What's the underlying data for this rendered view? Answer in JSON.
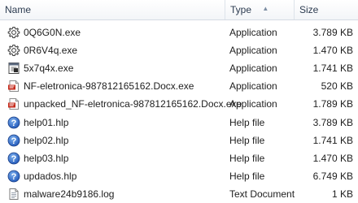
{
  "columns": {
    "name": "Name",
    "type": "Type",
    "type_sort_indicator": "▲",
    "size": "Size"
  },
  "files": [
    {
      "name": "0Q6G0N.exe",
      "type": "Application",
      "size": "3.789 KB",
      "icon": "gear-exe-icon"
    },
    {
      "name": "0R6V4q.exe",
      "type": "Application",
      "size": "1.470 KB",
      "icon": "gear-exe-icon"
    },
    {
      "name": "5x7q4x.exe",
      "type": "Application",
      "size": "1.741 KB",
      "icon": "app-exe-icon"
    },
    {
      "name": "NF-eletronica-987812165162.Docx.exe",
      "type": "Application",
      "size": "520 KB",
      "icon": "pdf-style-exe-icon"
    },
    {
      "name": "unpacked_NF-eletronica-987812165162.Docx.exe",
      "type": "Application",
      "size": "1.789 KB",
      "icon": "pdf-style-exe-icon"
    },
    {
      "name": "help01.hlp",
      "type": "Help file",
      "size": "3.789 KB",
      "icon": "help-file-icon"
    },
    {
      "name": "help02.hlp",
      "type": "Help file",
      "size": "1.741 KB",
      "icon": "help-file-icon"
    },
    {
      "name": "help03.hlp",
      "type": "Help file",
      "size": "1.470 KB",
      "icon": "help-file-icon"
    },
    {
      "name": "updados.hlp",
      "type": "Help file",
      "size": "6.749 KB",
      "icon": "help-file-icon"
    },
    {
      "name": "malware24b9186.log",
      "type": "Text Document",
      "size": "1 KB",
      "icon": "text-document-icon"
    }
  ]
}
